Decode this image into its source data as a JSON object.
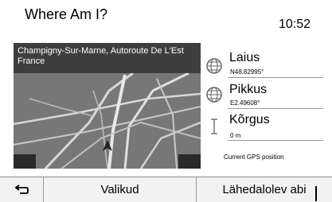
{
  "header": {
    "title": "Where Am I?",
    "time": "10:52"
  },
  "map": {
    "location_line1": "Champigny-Sur-Marne, Autoroute De L'Est",
    "location_line2": "France"
  },
  "info": {
    "latitude_label": "Laius",
    "latitude_value": "N48.82995°",
    "longitude_label": "Pikkus",
    "longitude_value": "E2.49608°",
    "altitude_label": "Kõrgus",
    "altitude_value": "0 m",
    "gps_note": "Current GPS position"
  },
  "bottom_bar": {
    "back_icon": "back-arrow-icon",
    "options_label": "Valikud",
    "nearby_label": "Lähedalolev abi"
  }
}
